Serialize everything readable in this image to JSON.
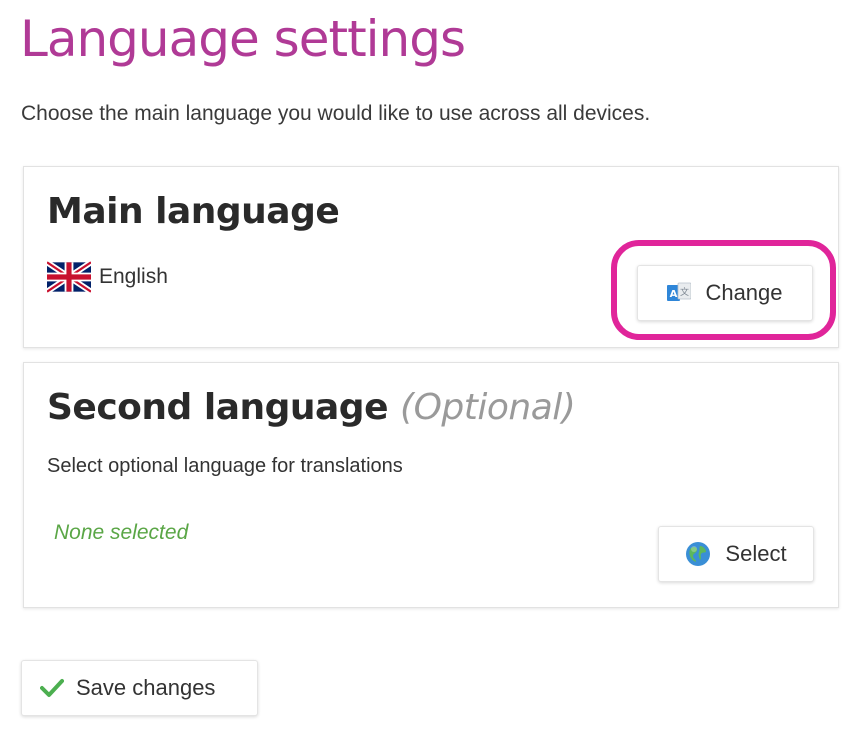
{
  "page": {
    "title": "Language settings",
    "description": "Choose the main language you would like to use across all devices."
  },
  "main_language": {
    "heading": "Main language",
    "current_language": "English",
    "flag_icon": "uk-flag-icon",
    "change_button_label": "Change",
    "change_button_icon": "translate-icon",
    "highlight_color": "#e0259a"
  },
  "second_language": {
    "heading": "Second language",
    "optional_tag": "(Optional)",
    "description": "Select optional language for translations",
    "status": "None selected",
    "select_button_label": "Select",
    "select_button_icon": "globe-icon"
  },
  "footer": {
    "save_button_label": "Save changes",
    "save_button_icon": "checkmark-icon"
  },
  "colors": {
    "title": "#b03a96",
    "status_green": "#5aa646",
    "checkmark_green": "#4caf50"
  }
}
